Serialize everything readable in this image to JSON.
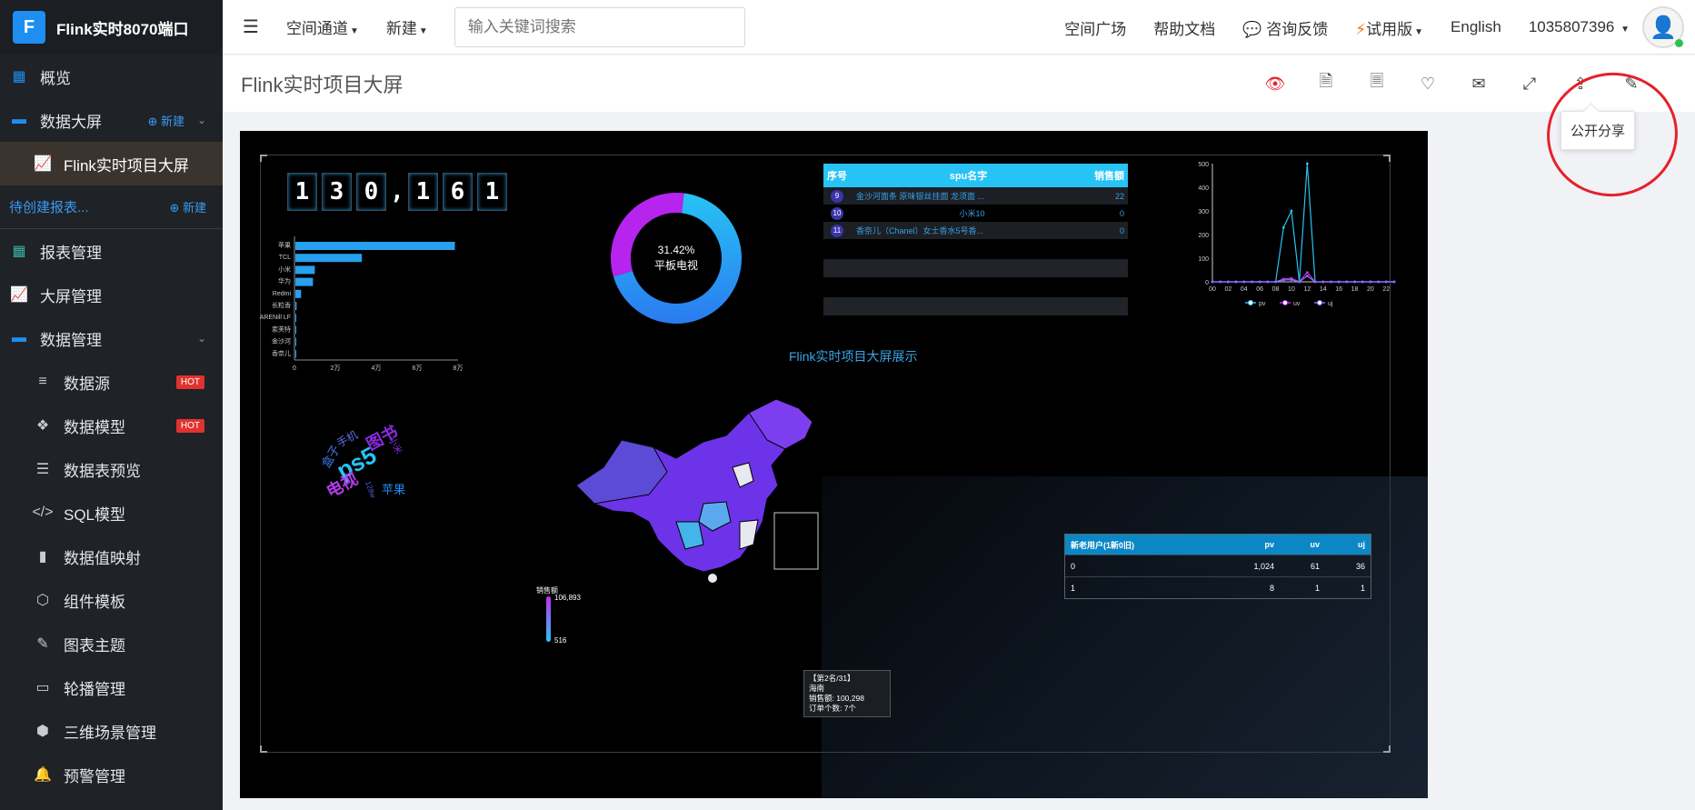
{
  "app": {
    "logo_letter": "F",
    "title": "Flink实时8070端口"
  },
  "sidebar": {
    "items": [
      {
        "label": "概览",
        "icon": "grid-icon"
      },
      {
        "label": "数据大屏",
        "icon": "folder-icon",
        "new": "新建"
      },
      {
        "label": "Flink实时项目大屏",
        "icon": "line-chart-icon"
      },
      {
        "label": "待创建报表...",
        "new": "新建"
      },
      {
        "label": "报表管理",
        "icon": "table-icon"
      },
      {
        "label": "大屏管理",
        "icon": "line-chart-icon"
      },
      {
        "label": "数据管理",
        "icon": "folder-icon"
      },
      {
        "label": "数据源",
        "icon": "database-icon",
        "badge": "HOT"
      },
      {
        "label": "数据模型",
        "icon": "cubes-icon",
        "badge": "HOT"
      },
      {
        "label": "数据表预览",
        "icon": "list-icon"
      },
      {
        "label": "SQL模型",
        "icon": "code-icon"
      },
      {
        "label": "数据值映射",
        "icon": "book-icon"
      },
      {
        "label": "组件模板",
        "icon": "cube-icon"
      },
      {
        "label": "图表主题",
        "icon": "magic-wand-icon"
      },
      {
        "label": "轮播管理",
        "icon": "monitor-icon"
      },
      {
        "label": "三维场景管理",
        "icon": "box-icon"
      },
      {
        "label": "预警管理",
        "icon": "bell-icon"
      }
    ]
  },
  "topbar": {
    "menu_space": "空间通道",
    "menu_new": "新建",
    "search_placeholder": "输入关键词搜索",
    "square": "空间广场",
    "docs": "帮助文档",
    "feedback": "咨询反馈",
    "trial": "试用版",
    "lang": "English",
    "user": "1035807396"
  },
  "page": {
    "title": "Flink实时项目大屏",
    "tooltip": "公开分享"
  },
  "colors": {
    "accent": "#1e8ef0",
    "cyan": "#27c3f4",
    "purple": "#8a2be2",
    "annotation": "#e6202a"
  },
  "dashboard": {
    "counter": [
      "1",
      "3",
      "0",
      ",",
      "1",
      "6",
      "1"
    ],
    "table": {
      "headers": [
        "序号",
        "spu名字",
        "销售额"
      ],
      "rows": [
        {
          "no": "9",
          "name": "金沙河面条 原味银丝挂面 龙须面 ...",
          "value": "22"
        },
        {
          "no": "10",
          "name": "小米10",
          "value": "0"
        },
        {
          "no": "11",
          "name": "香奈儿（Chanel）女士香水5号香...",
          "value": "0"
        }
      ]
    },
    "map_title": "Flink实时项目大屏展示",
    "map_tooltip": {
      "line1": "【第2名/31】",
      "line2": "海南",
      "line3": "销售额: 100,298",
      "line4": "订单个数: 7个"
    },
    "map_legend": {
      "max": "106,893",
      "min": "516",
      "label": "销售额"
    },
    "wordcloud": [
      "ps5",
      "电视",
      "图书",
      "盒子",
      "手机",
      "苹果",
      "小米",
      "128w"
    ],
    "new_users": {
      "headers": [
        "新老用户(1新0旧)",
        "pv",
        "uv",
        "uj"
      ],
      "rows": [
        [
          "0",
          "1,024",
          "61",
          "36"
        ],
        [
          "1",
          "8",
          "1",
          "1"
        ]
      ]
    }
  },
  "chart_data": [
    {
      "type": "bar",
      "orientation": "horizontal",
      "categories": [
        "苹果",
        "TCL",
        "小米",
        "华为",
        "Redmi",
        "长粒香",
        "ARENill LF",
        "索芙特",
        "金沙河",
        "香奈儿"
      ],
      "values": [
        78000,
        32500,
        9500,
        8600,
        2800,
        600,
        400,
        300,
        200,
        100
      ],
      "tick_labels": [
        "0",
        "2万",
        "4万",
        "6万",
        "8万"
      ],
      "xlim": [
        0,
        80000
      ]
    },
    {
      "type": "pie",
      "donut": true,
      "center_label": [
        "31.42%",
        "平板电视"
      ],
      "values": [
        68.58,
        31.42
      ]
    },
    {
      "type": "line",
      "x": [
        "00",
        "01",
        "02",
        "03",
        "04",
        "05",
        "06",
        "07",
        "08",
        "09",
        "10",
        "11",
        "12",
        "13",
        "14",
        "15",
        "16",
        "17",
        "18",
        "19",
        "20",
        "21",
        "22",
        "23"
      ],
      "x_tick_labels": [
        "00",
        "02",
        "04",
        "06",
        "08",
        "10",
        "12",
        "14",
        "16",
        "18",
        "20",
        "22"
      ],
      "ylim": [
        0,
        500
      ],
      "y_ticks": [
        0,
        100,
        200,
        300,
        400,
        500
      ],
      "series": [
        {
          "name": "pv",
          "color": "#27c3f4",
          "values": [
            0,
            0,
            0,
            0,
            0,
            0,
            0,
            0,
            0,
            230,
            300,
            0,
            500,
            0,
            0,
            0,
            0,
            0,
            0,
            0,
            0,
            0,
            0,
            0
          ]
        },
        {
          "name": "uv",
          "color": "#c030f0",
          "values": [
            0,
            0,
            0,
            0,
            0,
            0,
            0,
            0,
            0,
            12,
            15,
            0,
            40,
            0,
            0,
            0,
            0,
            0,
            0,
            0,
            0,
            0,
            0,
            0
          ]
        },
        {
          "name": "uj",
          "color": "#8a6cff",
          "values": [
            0,
            0,
            0,
            0,
            0,
            0,
            0,
            0,
            0,
            8,
            9,
            0,
            25,
            0,
            0,
            0,
            0,
            0,
            0,
            0,
            0,
            0,
            0,
            0
          ]
        }
      ]
    }
  ]
}
